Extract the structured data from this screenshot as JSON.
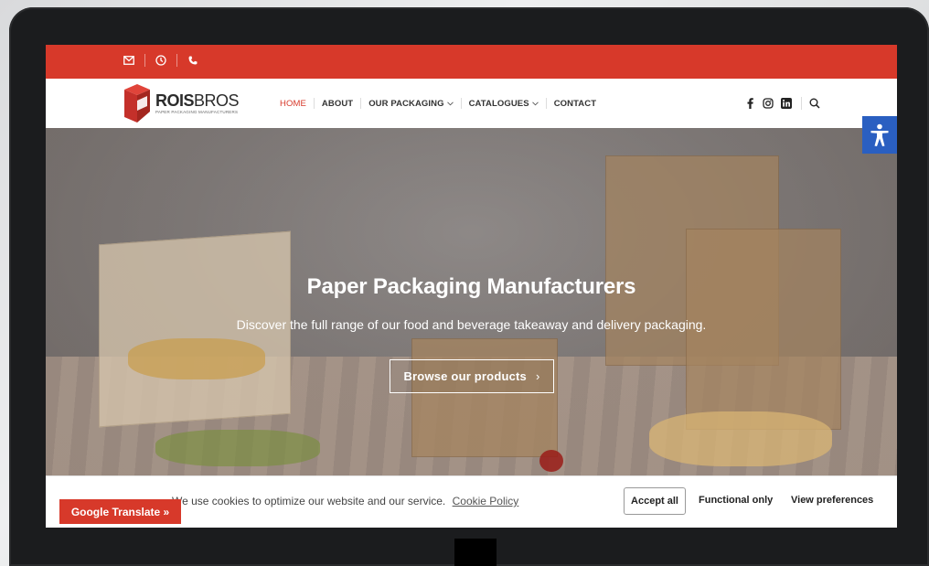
{
  "topbar": {
    "icons": [
      "envelope-icon",
      "clock-icon",
      "phone-icon"
    ]
  },
  "nav": {
    "logo": {
      "brand_bold": "ROIS",
      "brand_light": "BROS",
      "tagline": "PAPER PACKAGING MANUFACTURERS"
    },
    "menu": [
      {
        "label": "HOME",
        "active": true
      },
      {
        "label": "ABOUT"
      },
      {
        "label": "OUR PACKAGING",
        "dropdown": true
      },
      {
        "label": "CATALOGUES",
        "dropdown": true
      },
      {
        "label": "CONTACT"
      }
    ],
    "social_icons": [
      "facebook-icon",
      "instagram-icon",
      "linkedin-icon"
    ],
    "search_icon": "search-icon"
  },
  "hero": {
    "title": "Paper Packaging Manufacturers",
    "subtitle": "Discover the full range of our food and beverage takeaway and delivery packaging.",
    "cta_label": "Browse our products",
    "cta_arrow": "›"
  },
  "cookie_bar": {
    "text": "We use cookies to optimize our website and our service.",
    "link": "Cookie Policy",
    "accept_label": "Accept all",
    "functional_label": "Functional only",
    "preferences_label": "View preferences"
  },
  "google_translate": {
    "label": "Google Translate »"
  },
  "colors": {
    "brand_red": "#d7392a",
    "accessibility_blue": "#2a5fc1"
  }
}
